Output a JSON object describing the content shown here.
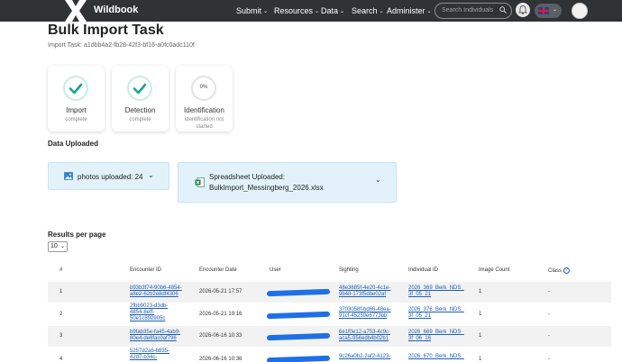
{
  "navbar": {
    "brand": "Wildbook",
    "menu": [
      {
        "label": "Submit"
      },
      {
        "label": "Resources"
      },
      {
        "label": "Data"
      },
      {
        "label": "Search"
      },
      {
        "label": "Administer"
      }
    ],
    "search_placeholder": "Search Individuals"
  },
  "header": {
    "title": "Bulk Import Task",
    "task_id": "Import Task: a1dbb4a2-fb28-42f3-bf16-a0fc0adc110f"
  },
  "status_cards": [
    {
      "label": "Import",
      "status": "complete",
      "progress": 100
    },
    {
      "label": "Detection",
      "status": "complete",
      "progress": 100
    },
    {
      "label": "Identification",
      "status_line1": "identification not",
      "status_line2": "started",
      "percent": "0%"
    }
  ],
  "data_uploaded": {
    "heading": "Data Uploaded",
    "photos_label": "photos uploaded: 24",
    "spreadsheet_line1": "Spreadsheet Uploaded:",
    "spreadsheet_line2": "BulkImport_Messingberg_2026.xlsx"
  },
  "results_per_page": {
    "label": "Results per page",
    "value": "10"
  },
  "table": {
    "headers": {
      "num": "#",
      "encounter_id": "Encounter ID",
      "encounter_date": "Encounter Date",
      "user": "User",
      "sighting": "Sighting",
      "individual_id": "Individual ID",
      "image_count": "Image Count",
      "class": "Class"
    },
    "rows": [
      {
        "num": "1",
        "enc_l1": "b93b3f74-90b6-4854-",
        "enc_l2": "a8e2-62b2e8df4306",
        "date": "2026-05-21 17:57",
        "sight_l1": "48e3685f-4e20-4c1e-",
        "sight_l2": "9b48-173f5dbe02af",
        "ind_l1": "2026_369_Berk_NDS_",
        "ind_l2": "3f_05_21",
        "count": "1",
        "cls": "-"
      },
      {
        "num": "2",
        "enc_l1": "2fbb9023-d3db-",
        "enc_l2": "4854-8eff-",
        "enc_l3": "50e1c892905c",
        "date": "2026-05-21 19:16",
        "sight_l1": "3703058f-bd66-48ea-",
        "sight_l2": "91cf-45259e6773bb",
        "ind_l1": "2026_376_Berk_NDS_",
        "ind_l2": "3f_05_21",
        "count": "1",
        "cls": "-"
      },
      {
        "num": "3",
        "enc_l1": "b9fab35e-fa45-4ab9-",
        "enc_l2": "80e4-de8fac0af796",
        "date": "2026-06-16 10:33",
        "sight_l1": "6e1f0e12-a753-4c9c-",
        "sight_l2": "aca5-956edb4b02b1",
        "ind_l1": "2026_669_Berk_NDS_",
        "ind_l2": "3f_06_16",
        "count": "1",
        "cls": "-"
      },
      {
        "num": "4",
        "enc_l1": "5257d2a6-b835-",
        "enc_l2": "42d7-b34c-",
        "date": "2026-06-16 10:36",
        "sight_l1": "9c26a0b2-2af2-4123-",
        "ind_l1": "2026_670_Berk_NDS_",
        "count": "1",
        "cls": "-"
      }
    ]
  },
  "colors": {
    "navbar": "#303336",
    "accent_teal": "#1aa39a",
    "panel_bg": "#e3f2fa",
    "link": "#1a5fb4",
    "redaction": "#1f6fe6"
  }
}
